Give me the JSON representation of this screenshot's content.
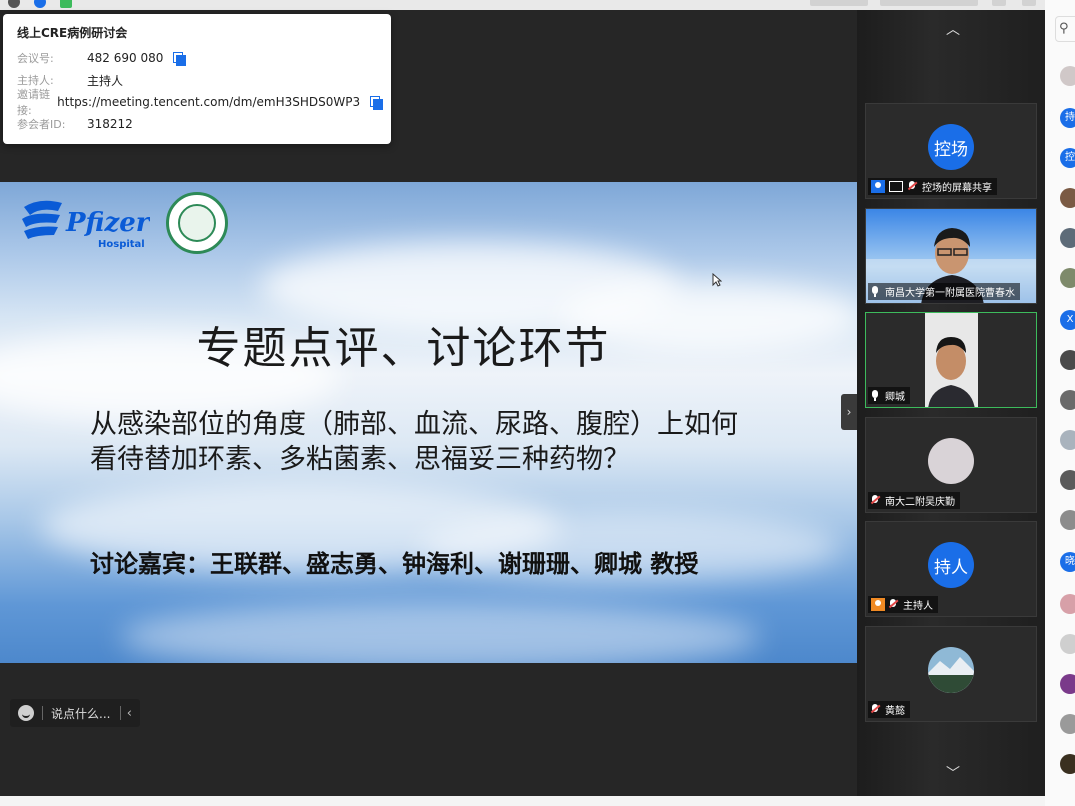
{
  "meeting_info": {
    "title": "线上CRE病例研讨会",
    "rows": [
      {
        "label": "会议号:",
        "value": "482 690 080",
        "copy": true
      },
      {
        "label": "主持人:",
        "value": "主持人",
        "copy": false
      },
      {
        "label": "邀请链接:",
        "value": "https://meeting.tencent.com/dm/emH3SHDS0WP3",
        "copy": true
      },
      {
        "label": "参会者ID:",
        "value": "318212",
        "copy": false
      }
    ]
  },
  "slide": {
    "logo_brand": "Pfizer",
    "logo_sub": "Hospital",
    "title": "专题点评、讨论环节",
    "question_line1": "从感染部位的角度（肺部、血流、尿路、腹腔）上如何",
    "question_line2": "看待替加环素、多粘菌素、思福妥三种药物？",
    "guests": "讨论嘉宾：王联群、盛志勇、钟海利、谢珊珊、卿城  教授"
  },
  "chat": {
    "placeholder": "说点什么..."
  },
  "participants": [
    {
      "name": "控场的屏幕共享",
      "avatar_text": "控场",
      "kind": "avatar",
      "badge": "blue-screen",
      "muted": true
    },
    {
      "name": "南昌大学第一附属医院曹春水",
      "kind": "video-man1",
      "muted": false
    },
    {
      "name": "卿城",
      "kind": "video-man2",
      "muted": false,
      "active": true
    },
    {
      "name": "南大二附吴庆勤",
      "kind": "photo-blank",
      "muted": true
    },
    {
      "name": "主持人",
      "avatar_text": "持人",
      "kind": "avatar",
      "badge": "orange",
      "muted": true
    },
    {
      "name": "黄懿",
      "kind": "photo-landscape",
      "muted": true
    }
  ],
  "right_list_labels": [
    "持",
    "控",
    "X",
    "晓"
  ],
  "colors": {
    "accent": "#1a6ee8",
    "active_border": "#3dbb5c",
    "host_badge": "#f08a24"
  }
}
